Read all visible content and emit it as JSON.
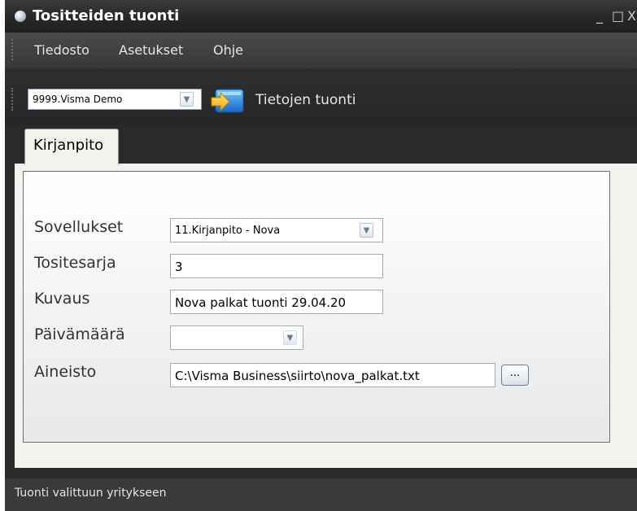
{
  "window": {
    "title": "Tositteiden tuonti",
    "minimize_glyph": "_",
    "maximize_glyph": "□",
    "close_glyph": "X"
  },
  "menu": {
    "items": [
      "Tiedosto",
      "Asetukset",
      "Ohje"
    ]
  },
  "toolbar": {
    "company_value": "9999.Visma Demo",
    "import_label": "Tietojen tuonti",
    "import_icon": "import-arrow-icon"
  },
  "tabs": [
    {
      "label": "Kirjanpito",
      "selected": true
    }
  ],
  "form": {
    "labels": {
      "applications": "Sovellukset",
      "voucher_series": "Tositesarja",
      "description": "Kuvaus",
      "date": "Päivämäärä",
      "file": "Aineisto"
    },
    "values": {
      "applications": "11.Kirjanpito - Nova",
      "voucher_series": "3",
      "description": "Nova palkat tuonti 29.04.20",
      "date": "",
      "file": "C:\\Visma Business\\siirto\\nova_palkat.txt"
    },
    "browse_label": "..."
  },
  "status": {
    "text": "Tuonti valittuun yritykseen"
  },
  "colors": {
    "chrome_dark": "#2a2a2a",
    "panel_bg": "#f2f2ee",
    "field_border": "#a5acb5"
  }
}
